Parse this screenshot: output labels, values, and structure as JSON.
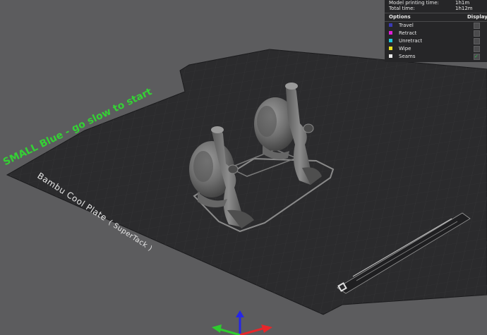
{
  "stats": {
    "model_time_label": "Model printing time:",
    "model_time_value": "1h1m",
    "total_time_label": "Total time:",
    "total_time_value": "1h12m"
  },
  "legend": {
    "options_header": "Options",
    "display_header": "Display",
    "items": [
      {
        "label": "Travel",
        "color": "#3a3ab4",
        "checked": false
      },
      {
        "label": "Retract",
        "color": "#e01fd5",
        "checked": false
      },
      {
        "label": "Unretract",
        "color": "#1fc8d8",
        "checked": false
      },
      {
        "label": "Wipe",
        "color": "#e8e020",
        "checked": false
      },
      {
        "label": "Seams",
        "color": "#e8e8e8",
        "checked": true
      }
    ]
  },
  "plate": {
    "label": "Bambu Cool Plate",
    "label_sub": "( SuperTack )",
    "note": "SMALL Blue - go slow to start"
  },
  "axis_colors": {
    "x": "#e8262a",
    "y": "#2ecc2e",
    "z": "#2626e8"
  }
}
